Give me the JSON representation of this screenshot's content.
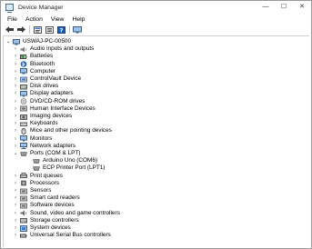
{
  "window": {
    "title": "Device Manager",
    "controls": {
      "minimize": "—",
      "maximize": "☐",
      "close": "✕"
    }
  },
  "menu": [
    "File",
    "Action",
    "View",
    "Help"
  ],
  "toolbar": [
    "back-icon",
    "forward-icon",
    "properties-icon",
    "help-icon",
    "monitor-icon"
  ],
  "tree": {
    "root": "USWAJ-PC-00500",
    "categories": [
      {
        "label": "Audio inputs and outputs",
        "icon": "speaker-icon",
        "color": "#7a7a7a"
      },
      {
        "label": "Batteries",
        "icon": "battery-icon",
        "color": "#3c8c3c"
      },
      {
        "label": "Bluetooth",
        "icon": "bluetooth-icon",
        "color": "#1f5fbf"
      },
      {
        "label": "Computer",
        "icon": "computer-icon",
        "color": "#3b7dc4"
      },
      {
        "label": "ControlVault Device",
        "icon": "controlvault-icon",
        "color": "#4a7ab0"
      },
      {
        "label": "Disk drives",
        "icon": "disk-icon",
        "color": "#707070"
      },
      {
        "label": "Display adapters",
        "icon": "display-adapter-icon",
        "color": "#3b7dc4"
      },
      {
        "label": "DVD/CD-ROM drives",
        "icon": "dvd-icon",
        "color": "#707070"
      },
      {
        "label": "Human Interface Devices",
        "icon": "hid-icon",
        "color": "#707070"
      },
      {
        "label": "Imaging devices",
        "icon": "camera-icon",
        "color": "#707070"
      },
      {
        "label": "Keyboards",
        "icon": "keyboard-icon",
        "color": "#707070"
      },
      {
        "label": "Mice and other pointing devices",
        "icon": "mouse-icon",
        "color": "#707070"
      },
      {
        "label": "Monitors",
        "icon": "monitor-icon",
        "color": "#3b7dc4"
      },
      {
        "label": "Network adapters",
        "icon": "network-icon",
        "color": "#3b7dc4"
      },
      {
        "label": "Ports (COM & LPT)",
        "icon": "port-icon",
        "color": "#707070",
        "expanded": true,
        "children": [
          {
            "label": "Arduino Uno (COM6)",
            "icon": "port-icon"
          },
          {
            "label": "ECP Printer Port (LPT1)",
            "icon": "port-icon"
          }
        ]
      },
      {
        "label": "Print queues",
        "icon": "printer-icon",
        "color": "#707070"
      },
      {
        "label": "Processors",
        "icon": "processor-icon",
        "color": "#707070"
      },
      {
        "label": "Sensors",
        "icon": "sensor-icon",
        "color": "#707070"
      },
      {
        "label": "Smart card readers",
        "icon": "smartcard-icon",
        "color": "#707070"
      },
      {
        "label": "Software devices",
        "icon": "software-device-icon",
        "color": "#707070"
      },
      {
        "label": "Sound, video and game controllers",
        "icon": "sound-icon",
        "color": "#707070"
      },
      {
        "label": "Storage controllers",
        "icon": "storage-icon",
        "color": "#707070"
      },
      {
        "label": "System devices",
        "icon": "system-device-icon",
        "color": "#3b7dc4"
      },
      {
        "label": "Universal Serial Bus controllers",
        "icon": "usb-icon",
        "color": "#707070"
      }
    ]
  }
}
